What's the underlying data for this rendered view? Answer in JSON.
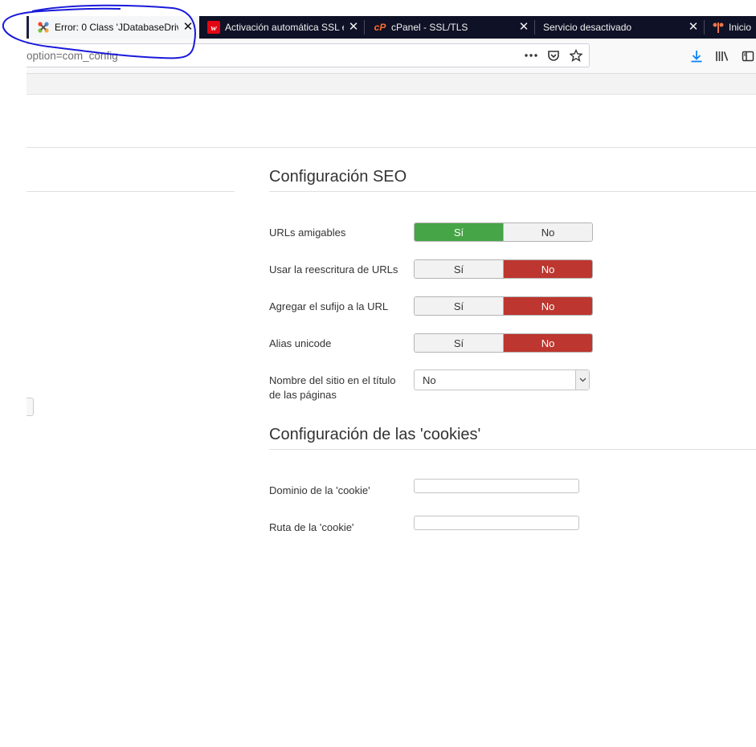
{
  "browser": {
    "tabs": [
      {
        "title": "Error: 0 Class 'JDatabaseDrive",
        "icon": "joomla-icon",
        "active": true
      },
      {
        "title": "Activación automática SSL e",
        "icon": "webempresa-icon",
        "active": false
      },
      {
        "title": "cPanel - SSL/TLS",
        "icon": "cpanel-icon",
        "active": false
      },
      {
        "title": "Servicio desactivado",
        "icon": "",
        "active": false
      },
      {
        "title": "Inicio",
        "icon": "inicio-icon",
        "active": false
      }
    ],
    "url_text": "option=com_config",
    "icons": [
      "more-icon",
      "pocket-icon",
      "bookmark-star-icon",
      "download-icon",
      "library-icon",
      "sidebar-icon"
    ]
  },
  "seo": {
    "title": "Configuración SEO",
    "rows": [
      {
        "label": "URLs amigables",
        "yes": "Sí",
        "no": "No",
        "state": "yes"
      },
      {
        "label": "Usar la reescritura de URLs",
        "yes": "Sí",
        "no": "No",
        "state": "no"
      },
      {
        "label": "Agregar el sufijo a la URL",
        "yes": "Sí",
        "no": "No",
        "state": "no"
      },
      {
        "label": "Alias unicode",
        "yes": "Sí",
        "no": "No",
        "state": "no"
      }
    ],
    "sitename": {
      "label": "Nombre del sitio en el título de las páginas",
      "value": "No"
    }
  },
  "cookies": {
    "title": "Configuración de las 'cookies'",
    "domain_label": "Dominio de la 'cookie'",
    "domain_value": "",
    "path_label": "Ruta de la 'cookie'",
    "path_value": ""
  },
  "colors": {
    "on_green": "#46a546",
    "on_red": "#bd362f",
    "annotation": "#1a1adb"
  }
}
